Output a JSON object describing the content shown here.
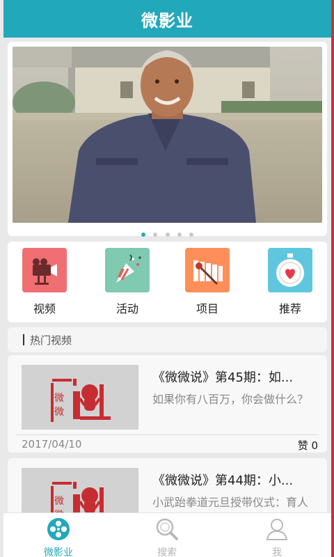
{
  "header": {
    "title": "微影业"
  },
  "banner": {
    "dots": 5,
    "active_dot": 0
  },
  "categories": [
    {
      "label": "视频",
      "icon": "video-camera-icon",
      "bg": "#ef6f73"
    },
    {
      "label": "活动",
      "icon": "party-popper-icon",
      "bg": "#7fcab0"
    },
    {
      "label": "项目",
      "icon": "xylophone-icon",
      "bg": "#ff8f5a"
    },
    {
      "label": "推荐",
      "icon": "stopwatch-heart-icon",
      "bg": "#5fc7dd"
    }
  ],
  "section": {
    "title": "热门视频"
  },
  "videos": [
    {
      "title": "《微微说》第45期：如...",
      "desc": "如果你有八百万，你会做什么？",
      "date": "2017/04/10",
      "like": "赞 0",
      "thumb_text": "微微说"
    },
    {
      "title": "《微微说》第44期：小...",
      "desc": "小武跆拳道元旦授带仪式：育人 育体 育人",
      "date": "",
      "like": "",
      "thumb_text": "微微说"
    }
  ],
  "tabbar": {
    "items": [
      {
        "label": "微影业",
        "icon": "film-reel-icon",
        "active": true
      },
      {
        "label": "搜索",
        "icon": "search-icon",
        "active": false
      },
      {
        "label": "我",
        "icon": "user-icon",
        "active": false
      }
    ]
  },
  "colors": {
    "accent": "#22a8bb",
    "logo_red": "#c62d32"
  }
}
